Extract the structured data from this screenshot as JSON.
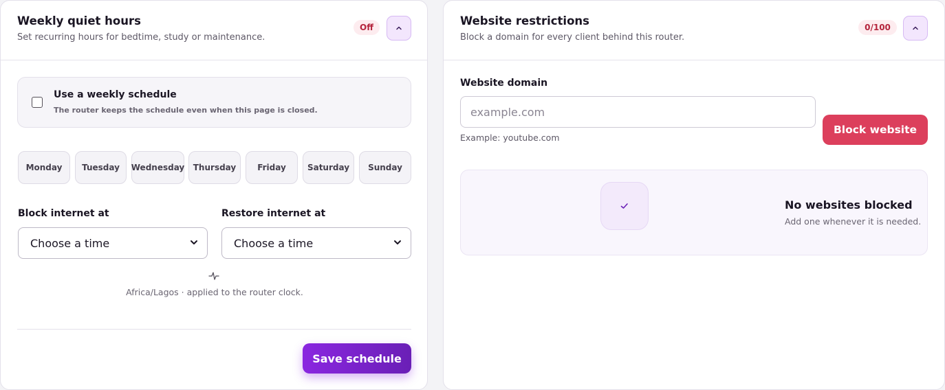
{
  "quiet_hours": {
    "title": "Weekly quiet hours",
    "subtitle": "Set recurring hours for bedtime, study or maintenance.",
    "status_badge": "Off",
    "collapse_icon": "chevron-up-icon",
    "schedule_toggle": {
      "checked": false,
      "title": "Use a weekly schedule",
      "description": "The router keeps the schedule even when this page is closed."
    },
    "days": [
      "Monday",
      "Tuesday",
      "Wednesday",
      "Thursday",
      "Friday",
      "Saturday",
      "Sunday"
    ],
    "block_label": "Block internet at",
    "block_value": "Choose a time",
    "restore_label": "Restore internet at",
    "restore_value": "Choose a time",
    "timezone_icon": "pulse-icon",
    "timezone_note": "Africa/Lagos · applied to the router clock.",
    "save_label": "Save schedule"
  },
  "website_restrictions": {
    "title": "Website restrictions",
    "subtitle": "Block a domain for every client behind this router.",
    "count_badge": "0/100",
    "collapse_icon": "chevron-up-icon",
    "domain_label": "Website domain",
    "domain_placeholder": "example.com",
    "domain_value": "",
    "domain_hint": "Example: youtube.com",
    "block_button": "Block website",
    "empty_state": {
      "icon": "check-icon",
      "title": "No websites blocked",
      "description": "Add one whenever it is needed."
    }
  },
  "colors": {
    "accent_purple": "#8a26e0",
    "danger_red": "#dc3f5c",
    "badge_red": "#b4243c"
  }
}
